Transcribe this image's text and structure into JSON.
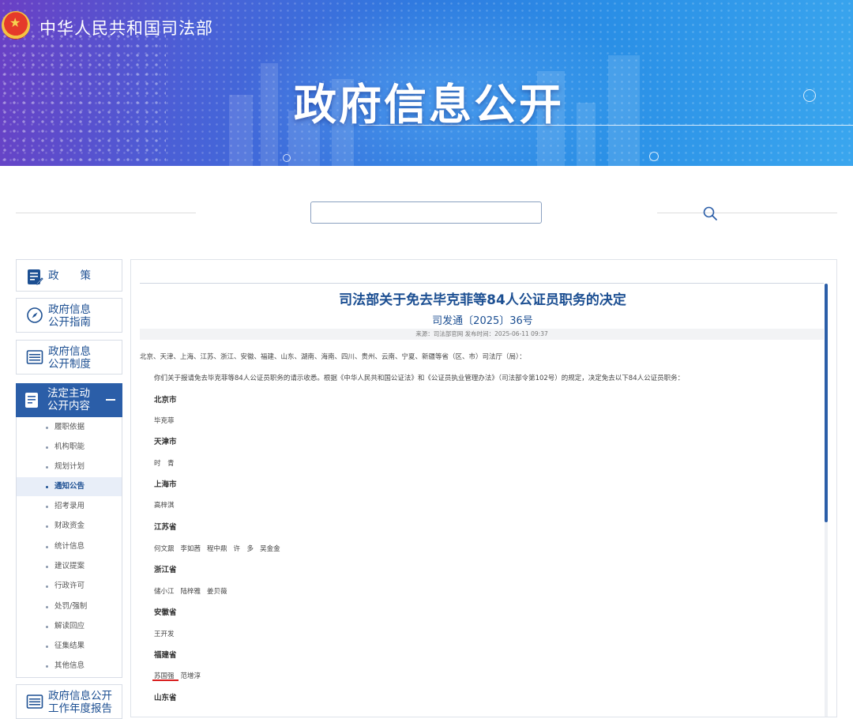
{
  "header": {
    "site_name": "中华人民共和国司法部",
    "banner_title": "政府信息公开"
  },
  "search": {
    "placeholder": ""
  },
  "sidebar": {
    "items": [
      {
        "label": "政　　策"
      },
      {
        "label_line1": "政府信息",
        "label_line2": "公开指南"
      },
      {
        "label_line1": "政府信息",
        "label_line2": "公开制度"
      },
      {
        "label_line1": "法定主动",
        "label_line2": "公开内容"
      },
      {
        "label_line1": "政府信息公开",
        "label_line2": "工作年度报告"
      }
    ],
    "sub_items": [
      "履职依据",
      "机构职能",
      "规划计划",
      "通知公告",
      "招考录用",
      "财政资金",
      "统计信息",
      "建议提案",
      "行政许可",
      "处罚/强制",
      "解读回应",
      "征集结果",
      "其他信息"
    ],
    "active_sub_item": "通知公告"
  },
  "document": {
    "title": "司法部关于免去毕克菲等84人公证员职务的决定",
    "number": "司发通〔2025〕36号",
    "meta": "来源：司法部官网 发布时间：2025-06-11 09:37",
    "addressee": "北京、天津、上海、江苏、浙江、安徽、福建、山东、湖南、海南、四川、贵州、云南、宁夏、新疆等省（区、市）司法厅（局）：",
    "intro": "你们关于报请免去毕克菲等84人公证员职务的请示收悉。根据《中华人民共和国公证法》和《公证员执业管理办法》（司法部令第102号）的规定，决定免去以下84人公证员职务：",
    "sections": [
      {
        "province": "北京市",
        "names": [
          "毕克菲"
        ]
      },
      {
        "province": "天津市",
        "names": [
          "时　青"
        ]
      },
      {
        "province": "上海市",
        "names": [
          "高梓淇"
        ]
      },
      {
        "province": "江苏省",
        "names": [
          "何文鼐",
          "李如茜",
          "程中鼎",
          "许　多",
          "吴金金"
        ]
      },
      {
        "province": "浙江省",
        "names": [
          "储小江",
          "陆梓雅",
          "姜贝薇"
        ]
      },
      {
        "province": "安徽省",
        "names": [
          "王开发"
        ]
      },
      {
        "province": "福建省",
        "names": [
          "苏国强",
          "范增淳"
        ]
      },
      {
        "province": "山东省",
        "names": []
      }
    ]
  },
  "colors": {
    "accent": "#1c4f92",
    "active_bg": "#2b5ea8",
    "highlight": "#d81b1b"
  }
}
